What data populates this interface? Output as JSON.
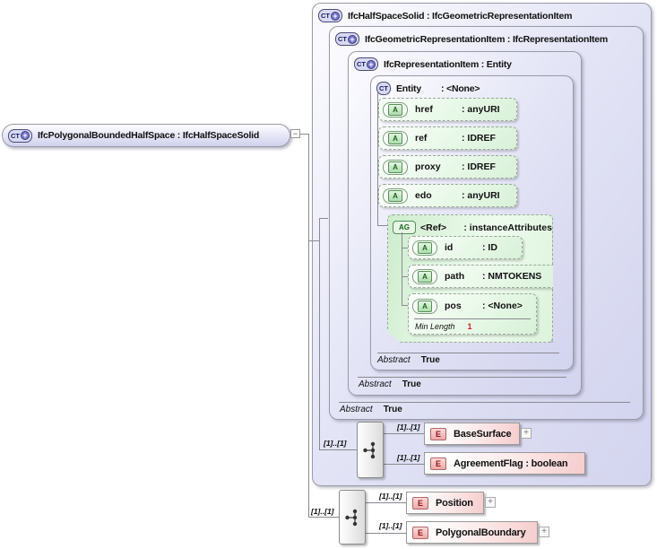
{
  "root": {
    "icon": "CT",
    "icon_plus": "+",
    "label": "IfcPolygonalBoundedHalfSpace : IfcHalfSpaceSolid",
    "collapse": "−"
  },
  "boxes": {
    "box1": {
      "icon": "CT",
      "icon_plus": "+",
      "title": "IfcHalfSpaceSolid : IfcGeometricRepresentationItem"
    },
    "box2": {
      "icon": "CT",
      "icon_plus": "+",
      "title": "IfcGeometricRepresentationItem : IfcRepresentationItem",
      "facet": {
        "label": "Abstract",
        "value": "True"
      }
    },
    "box3": {
      "icon": "CT",
      "icon_plus": "+",
      "title": "IfcRepresentationItem : Entity",
      "facet": {
        "label": "Abstract",
        "value": "True"
      }
    },
    "entity": {
      "icon": "CT",
      "name": "Entity",
      "type": ": <None>",
      "facet": {
        "label": "Abstract",
        "value": "True"
      }
    }
  },
  "entity_attributes": [
    {
      "icon": "A",
      "name": "href",
      "type": ": anyURI"
    },
    {
      "icon": "A",
      "name": "ref",
      "type": ": IDREF"
    },
    {
      "icon": "A",
      "name": "proxy",
      "type": ": IDREF"
    },
    {
      "icon": "A",
      "name": "edo",
      "type": ": anyURI"
    }
  ],
  "attribute_group": {
    "icon": "AG",
    "name": "<Ref>",
    "type": ": instanceAttributes",
    "attributes": [
      {
        "icon": "A",
        "name": "id",
        "type": ": ID"
      },
      {
        "icon": "A",
        "name": "path",
        "type": ": NMTOKENS"
      },
      {
        "icon": "A",
        "name": "pos",
        "type": ": <None>",
        "facet": {
          "label": "Min Length",
          "value": "1"
        }
      }
    ]
  },
  "content_model": {
    "inner_sequence": {
      "occurs": "[1]..[1]",
      "children": [
        {
          "icon": "E",
          "occurs": "[1]..[1]",
          "label": "BaseSurface",
          "expand": "+"
        },
        {
          "icon": "E",
          "occurs": "[1]..[1]",
          "label": "AgreementFlag : boolean"
        }
      ]
    },
    "outer_sequence": {
      "occurs": "[1]..[1]",
      "children": [
        {
          "icon": "E",
          "occurs": "[1]..[1]",
          "label": "Position",
          "expand": "+"
        },
        {
          "icon": "E",
          "occurs": "[1]..[1]",
          "label": "PolygonalBoundary",
          "expand": "+"
        }
      ]
    }
  },
  "colors": {
    "lavender": "#d5d6ee",
    "attr_green": "#ddf3dd",
    "element_pink": "#f5cdcd",
    "facet_value_red": "#cc2222"
  }
}
